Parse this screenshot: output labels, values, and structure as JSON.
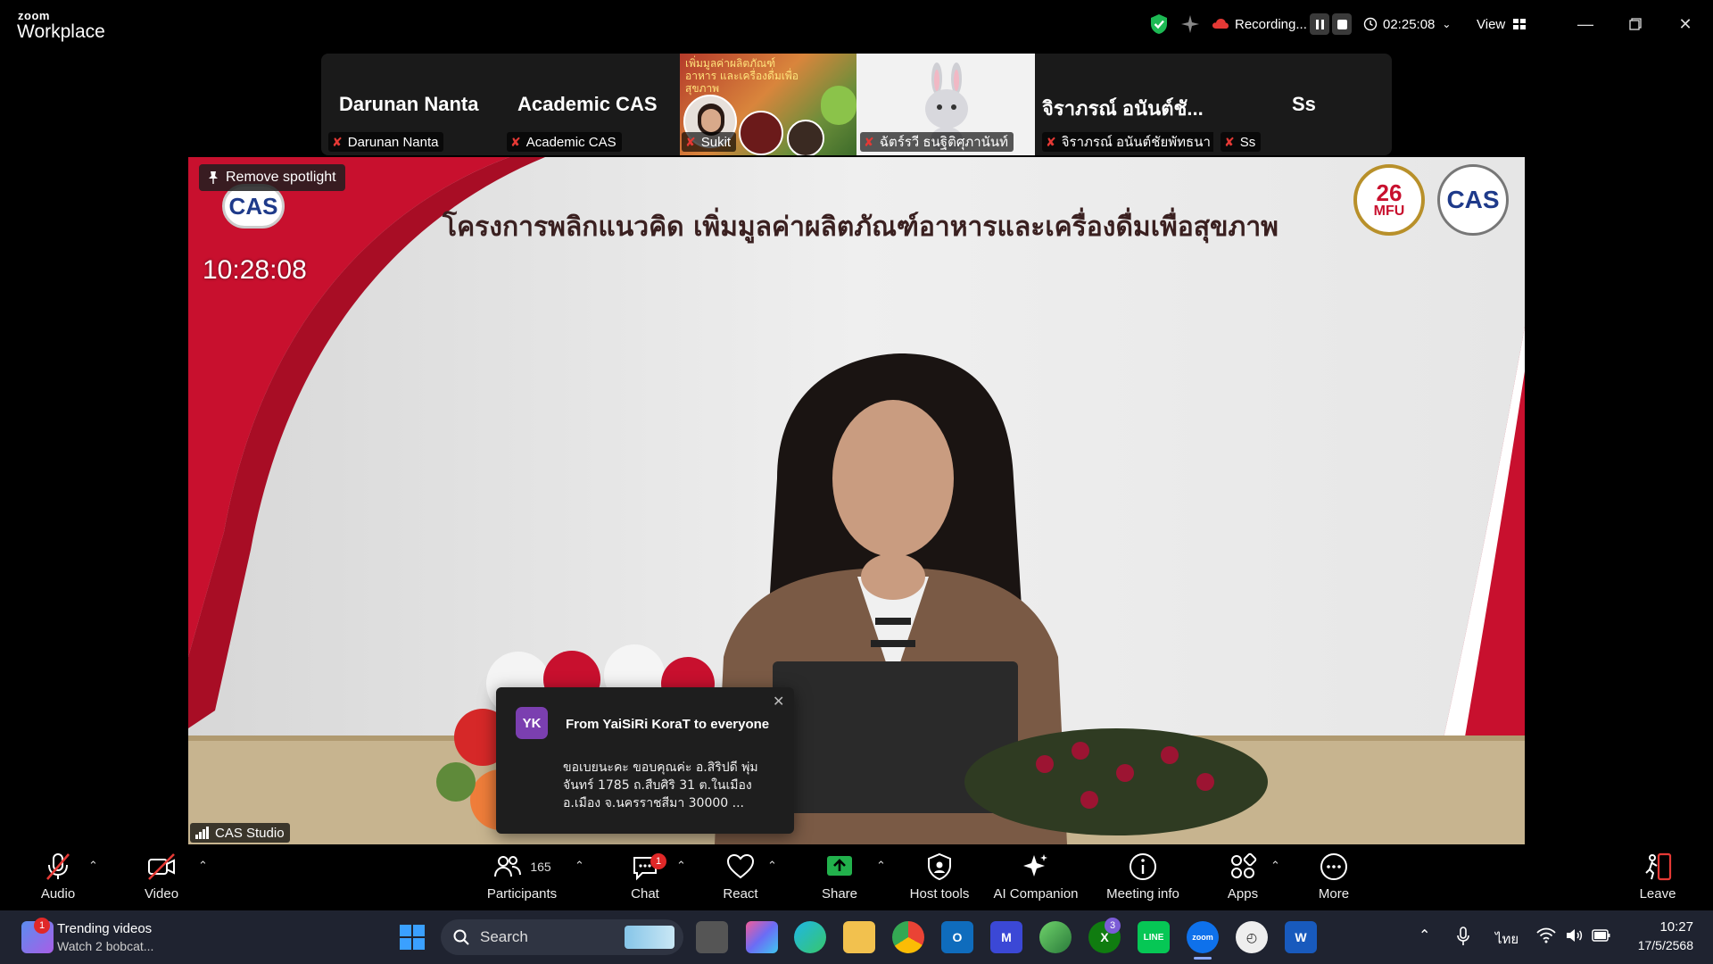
{
  "app": {
    "logo_small": "zoom",
    "logo_big": "Workplace"
  },
  "titlebar": {
    "recording_label": "Recording...",
    "timer": "02:25:08",
    "view_label": "View"
  },
  "thumbnails": [
    {
      "big_name": "Darunan Nanta",
      "label": "Darunan Nanta"
    },
    {
      "big_name": "Academic CAS",
      "label": "Academic CAS"
    },
    {
      "big_name": "",
      "label": "Sukit"
    },
    {
      "big_name": "",
      "label": "ฉัตร์รวี ธนฐิติศุภานันท์"
    },
    {
      "big_name": "จิราภรณ์ อนันต์ชั...",
      "label": "จิราภรณ์ อนันต์ชัยพัทธนา"
    },
    {
      "big_name": "Ss",
      "label": "Ss"
    }
  ],
  "video": {
    "spotlight_label": "Remove spotlight",
    "clock": "10:28:08",
    "title": "โครงการพลิกแนวคิด เพิ่มมูลค่าผลิตภัณฑ์อาหารและเครื่องดื่มเพื่อสุขภาพ",
    "logo_left": "CAS",
    "logo_right1_num": "26",
    "logo_right1_text": "MFU",
    "logo_right2": "CAS",
    "studio_label": "CAS Studio",
    "thumb_banner": "เพิ่มมูลค่าผลิตภัณฑ์อาหาร และเครื่องดื่มเพื่อสุขภาพ"
  },
  "chat_popup": {
    "initials": "YK",
    "from": "From YaiSiRi KoraT to everyone",
    "message": "ขอเบยนะคะ ขอบคุณค่ะ อ.สิริปดี พุ่มจันทร์ 1785 ถ.สืบศิริ 31 ต.ในเมือง อ.เมือง จ.นครราชสีมา 30000 ..."
  },
  "toolbar": {
    "audio": "Audio",
    "video": "Video",
    "participants": "Participants",
    "participants_count": "165",
    "chat": "Chat",
    "chat_badge": "1",
    "react": "React",
    "share": "Share",
    "host_tools": "Host tools",
    "ai_companion": "AI Companion",
    "meeting_info": "Meeting info",
    "apps": "Apps",
    "more": "More",
    "leave": "Leave"
  },
  "taskbar": {
    "widget_title": "Trending videos",
    "widget_sub": "Watch 2 bobcat...",
    "widget_badge": "1",
    "search_label": "Search",
    "xbox_badge": "3",
    "lang": "ไทย",
    "time": "10:27",
    "date": "17/5/2568"
  },
  "colors": {
    "accent_blue": "#0e71eb",
    "record_red": "#e53935",
    "share_green": "#22b14c",
    "shield_green": "#1db954"
  }
}
